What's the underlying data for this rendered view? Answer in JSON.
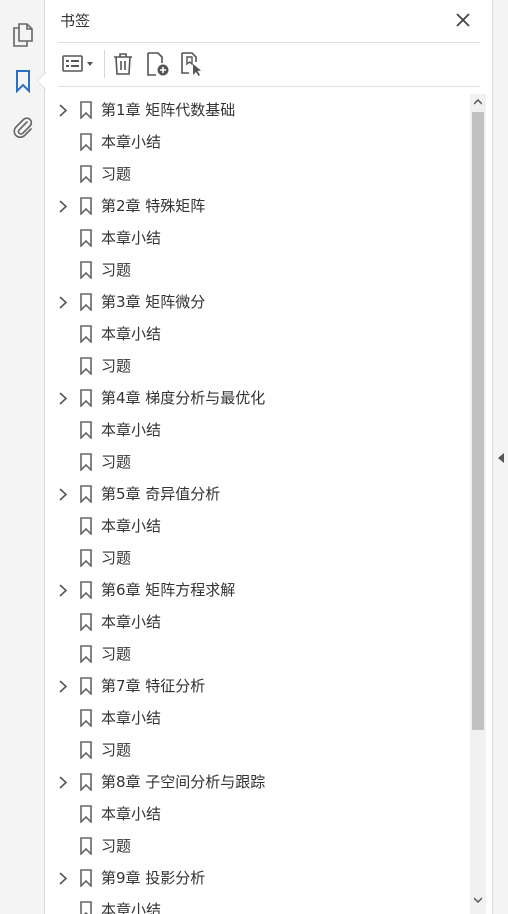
{
  "panel": {
    "title": "书签"
  },
  "rail": {
    "icons": [
      "pages-icon",
      "bookmark-icon",
      "attachment-icon"
    ],
    "active": "bookmark-icon",
    "active_color": "#2c6fc7"
  },
  "toolbar": {
    "icons": [
      "options-menu-icon",
      "delete-icon",
      "new-bookmark-icon",
      "bookmark-from-selection-icon"
    ]
  },
  "bookmarks": [
    {
      "label": "第1章 矩阵代数基础",
      "expandable": true
    },
    {
      "label": "本章小结",
      "expandable": false
    },
    {
      "label": "习题",
      "expandable": false
    },
    {
      "label": "第2章 特殊矩阵",
      "expandable": true
    },
    {
      "label": "本章小结",
      "expandable": false
    },
    {
      "label": "习题",
      "expandable": false
    },
    {
      "label": "第3章 矩阵微分",
      "expandable": true
    },
    {
      "label": "本章小结",
      "expandable": false
    },
    {
      "label": "习题",
      "expandable": false
    },
    {
      "label": "第4章 梯度分析与最优化",
      "expandable": true
    },
    {
      "label": "本章小结",
      "expandable": false
    },
    {
      "label": "习题",
      "expandable": false
    },
    {
      "label": "第5章 奇异值分析",
      "expandable": true
    },
    {
      "label": "本章小结",
      "expandable": false
    },
    {
      "label": "习题",
      "expandable": false
    },
    {
      "label": "第6章 矩阵方程求解",
      "expandable": true
    },
    {
      "label": "本章小结",
      "expandable": false
    },
    {
      "label": "习题",
      "expandable": false
    },
    {
      "label": "第7章 特征分析",
      "expandable": true
    },
    {
      "label": "本章小结",
      "expandable": false
    },
    {
      "label": "习题",
      "expandable": false
    },
    {
      "label": "第8章 子空间分析与跟踪",
      "expandable": true
    },
    {
      "label": "本章小结",
      "expandable": false
    },
    {
      "label": "习题",
      "expandable": false
    },
    {
      "label": "第9章 投影分析",
      "expandable": true
    },
    {
      "label": "本章小结",
      "expandable": false
    }
  ]
}
